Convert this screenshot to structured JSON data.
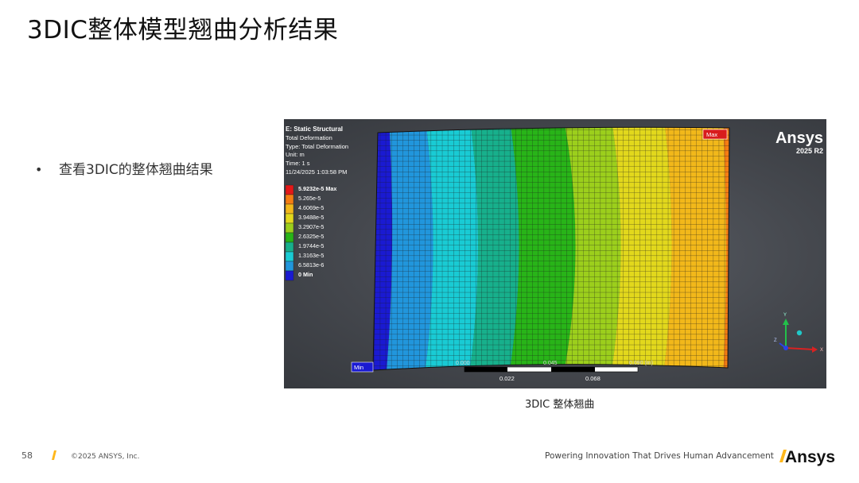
{
  "slide": {
    "title": "3DIC整体模型翘曲分析结果",
    "bullet_marker": "•",
    "bullet_text": "查看3DIC的整体翘曲结果",
    "caption": "3DIC 整体翘曲"
  },
  "viewer": {
    "info_lines": [
      "E: Static Structural",
      "Total Deformation",
      "Type: Total Deformation",
      "Unit: m",
      "Time: 1 s",
      "11/24/2025 1:03:58 PM"
    ],
    "legend": {
      "labels": [
        "5.9232e-5 Max",
        "5.265e-5",
        "4.6069e-5",
        "3.9488e-5",
        "3.2907e-5",
        "2.6325e-5",
        "1.9744e-5",
        "1.3163e-5",
        "6.5813e-6",
        "0 Min"
      ],
      "colors": [
        "#e41818",
        "#f57c12",
        "#f2b81a",
        "#e2d81c",
        "#9ccf1c",
        "#28b418",
        "#17b08c",
        "#19cbd4",
        "#2196dc",
        "#1a1ad2"
      ]
    },
    "brand": "Ansys",
    "version": "2025 R2",
    "max_tag": "Max",
    "min_tag": "Min",
    "scale": {
      "top_labels": [
        "0.000",
        "0.045",
        "0.090 (m)"
      ],
      "bottom_labels": [
        "0.022",
        "0.068"
      ]
    },
    "triad": {
      "y": "Y",
      "x": "X",
      "z": "Z"
    }
  },
  "footer": {
    "page_number": "58",
    "copyright": "©2025 ANSYS, Inc.",
    "tagline": "Powering Innovation That Drives Human Advancement",
    "logo_text": "Ansys",
    "slash_color": "#ffb71b"
  }
}
